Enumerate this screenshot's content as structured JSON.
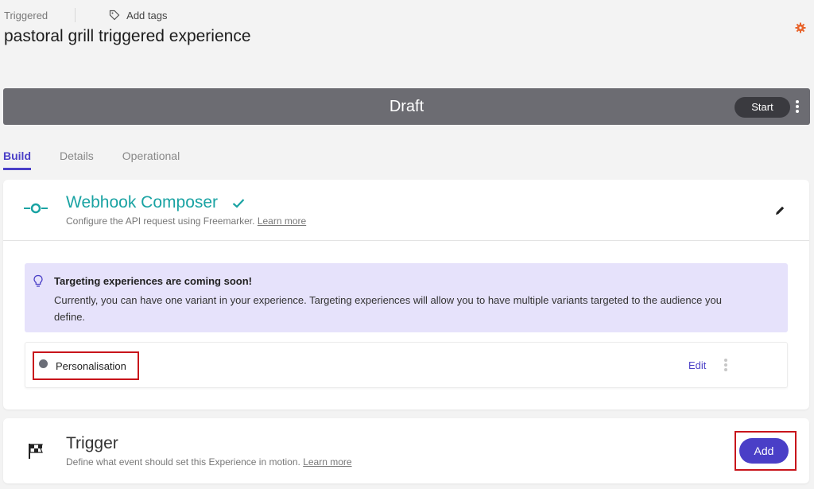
{
  "header": {
    "type_label": "Triggered",
    "add_tags_label": "Add tags",
    "title": "pastoral grill triggered experience",
    "icons": {
      "tag": "tag-icon",
      "settings": "gear-icon"
    },
    "accent_color": "#e8632b"
  },
  "status_bar": {
    "status": "Draft",
    "start_label": "Start",
    "menu_icon": "kebab-menu-icon",
    "background_color": "#6c6c72"
  },
  "tabs": [
    {
      "label": "Build",
      "active": true
    },
    {
      "label": "Details",
      "active": false
    },
    {
      "label": "Operational",
      "active": false
    }
  ],
  "webhook_card": {
    "title": "Webhook Composer",
    "subtitle": "Configure the API request using Freemarker.",
    "learn_more": "Learn more",
    "title_color": "#1aa3a3",
    "icons": {
      "component": "webhook-icon",
      "status": "check-icon",
      "edit": "pencil-icon"
    },
    "notice": {
      "icon": "lightbulb-icon",
      "title": "Targeting experiences are coming soon!",
      "body": "Currently, you can have one variant in your experience. Targeting experiences will allow you to have multiple variants targeted to the audience you define.",
      "background_color": "#e6e2fb"
    },
    "variant": {
      "name": "Personalisation",
      "edit_label": "Edit"
    }
  },
  "trigger_card": {
    "title": "Trigger",
    "subtitle": "Define what event should set this Experience in motion.",
    "learn_more": "Learn more",
    "add_label": "Add",
    "icon": "checkered-flag-icon",
    "button_color": "#4a3fc7"
  }
}
